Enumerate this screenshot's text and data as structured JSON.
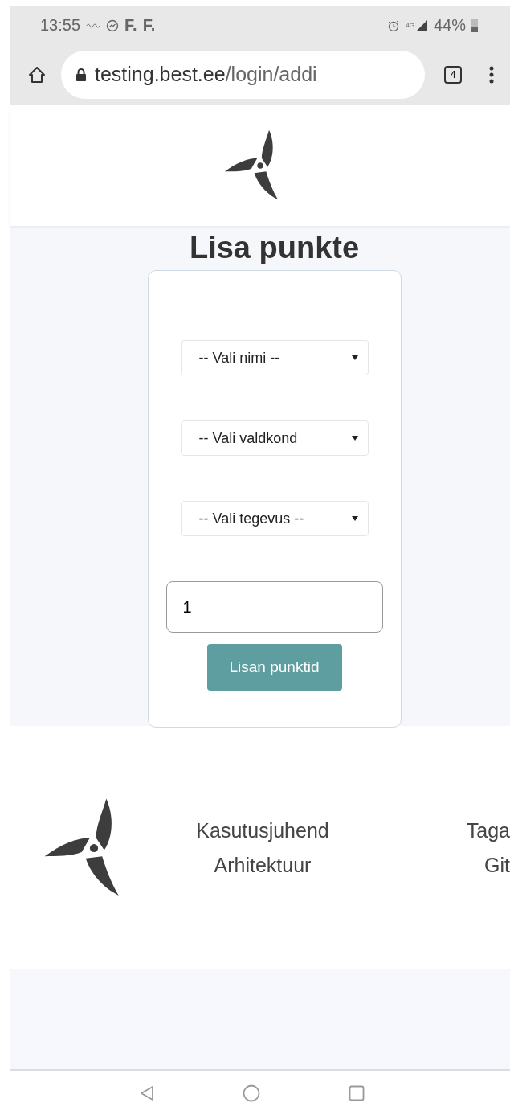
{
  "status_bar": {
    "time": "13:55",
    "notification_letters": [
      "F.",
      "F."
    ],
    "network": "4G",
    "battery": "44%"
  },
  "browser": {
    "url_host": "testing.best.ee",
    "url_path": "/login/addi",
    "tab_count": "4"
  },
  "page": {
    "title": "Lisa punkte",
    "selects": [
      {
        "value": "-- Vali nimi --"
      },
      {
        "value": "-- Vali valdkond"
      },
      {
        "value": "-- Vali tegevus --"
      }
    ],
    "points_field": {
      "value": "1"
    },
    "submit": "Lisan punktid"
  },
  "footer": {
    "links": [
      [
        "Kasutusjuhend",
        "Arhitektuur"
      ],
      [
        "Taga",
        "Git"
      ]
    ]
  }
}
